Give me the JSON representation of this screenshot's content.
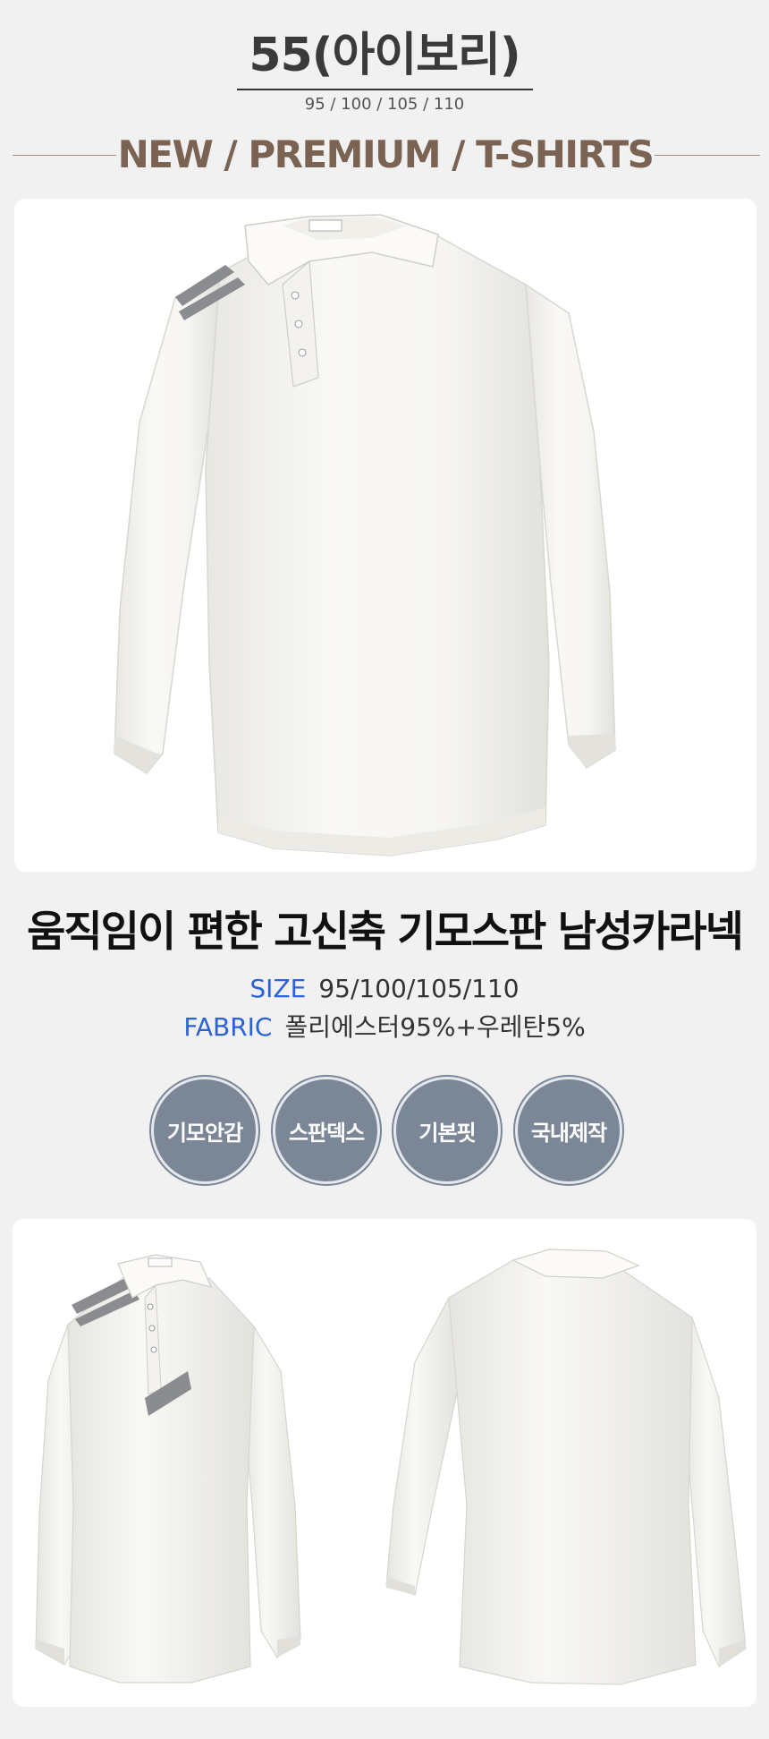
{
  "header": {
    "model_title": "55(아이보리)",
    "sizes_line": "95 / 100 / 105 / 110",
    "tagline": "NEW / PREMIUM / T-SHIRTS"
  },
  "product": {
    "name": "움직임이 편한 고신축 기모스판 남성카라넥",
    "size_label": "SIZE",
    "size_value": "95/100/105/110",
    "fabric_label": "FABRIC",
    "fabric_value": "폴리에스터95%+우레탄5%"
  },
  "features": [
    "기모안감",
    "스판덱스",
    "기본핏",
    "국내제작"
  ],
  "colors": {
    "background": "#f1f1f1",
    "tagline": "#7b6354",
    "spec_label": "#2c62d8",
    "badge": "#7b8697",
    "shirt": "#f6f5f1",
    "stripe": "#8a8c90"
  }
}
